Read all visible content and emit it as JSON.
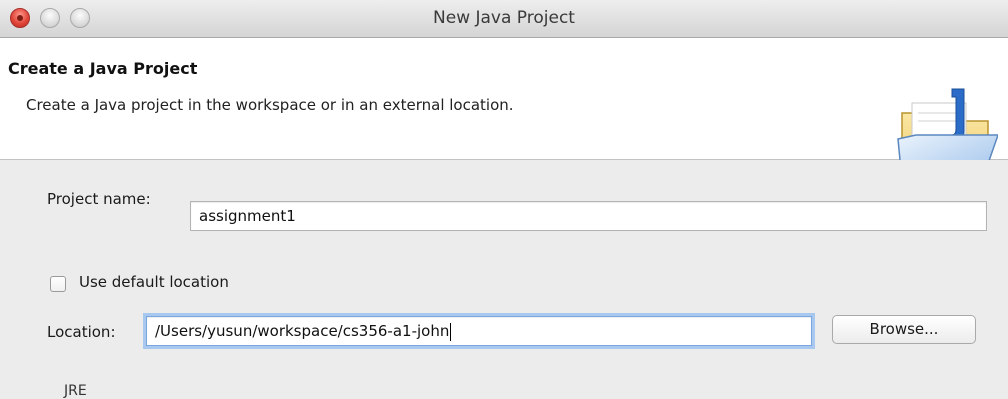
{
  "window": {
    "title": "New Java Project"
  },
  "header": {
    "title": "Create a Java Project",
    "description": "Create a Java project in the workspace or in an external location.",
    "icon": "java-project-folder-icon"
  },
  "form": {
    "project_name_label": "Project name:",
    "project_name_value": "assignment1",
    "use_default_location_label": "Use default location",
    "use_default_location_checked": false,
    "location_label": "Location:",
    "location_value": "/Users/yusun/workspace/cs356-a1-john",
    "browse_label": "Browse...",
    "jre_label": "JRE"
  },
  "colors": {
    "focus_ring": "#a9c8ef",
    "java_blue": "#2a6cc7"
  }
}
